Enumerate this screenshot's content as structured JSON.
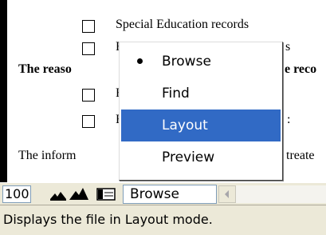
{
  "document": {
    "lines": [
      {
        "text": "Special Education records",
        "bold": false
      },
      {
        "text": "F",
        "bold": false
      },
      {
        "text": "s",
        "bold": false
      },
      {
        "text": "The reaso",
        "bold": true
      },
      {
        "text": "e reco",
        "bold": true
      },
      {
        "text": "F",
        "bold": false
      },
      {
        "text": "F",
        "bold": false
      },
      {
        "text": ":",
        "bold": false
      },
      {
        "text": "The inform",
        "bold": false
      },
      {
        "text": "treate",
        "bold": false
      }
    ]
  },
  "mode_menu": {
    "items": [
      {
        "label": "Browse",
        "checked": true,
        "highlighted": false
      },
      {
        "label": "Find",
        "checked": false,
        "highlighted": false
      },
      {
        "label": "Layout",
        "checked": false,
        "highlighted": true
      },
      {
        "label": "Preview",
        "checked": false,
        "highlighted": false
      }
    ]
  },
  "toolbar": {
    "zoom_level": "100",
    "mode_value": "Browse"
  },
  "statusbar": {
    "text": "Displays the file in Layout mode."
  },
  "colors": {
    "highlight": "#316ac5",
    "chrome": "#ece9d8"
  }
}
